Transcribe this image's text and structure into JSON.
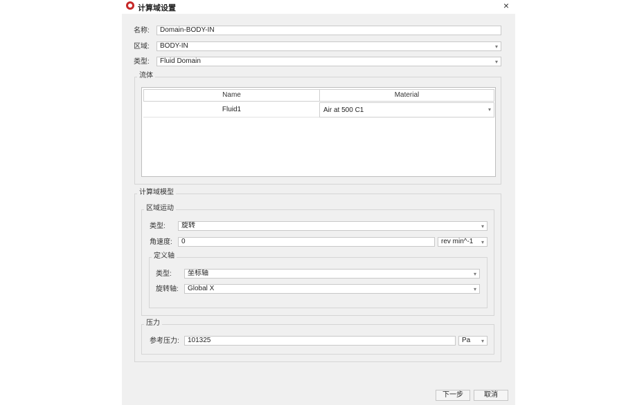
{
  "window": {
    "title": "计算域设置",
    "close_label": "×"
  },
  "general": {
    "name_label": "名称:",
    "name_value": "Domain-BODY-IN",
    "zone_label": "区域:",
    "zone_value": "BODY-IN",
    "type_label": "类型:",
    "type_value": "Fluid Domain"
  },
  "fluid": {
    "group_title": "流体",
    "columns": [
      "Name",
      "Material"
    ],
    "rows": [
      {
        "name": "Fluid1",
        "material": "Air at 500 C1"
      }
    ]
  },
  "domain_model": {
    "group_title": "计算域模型",
    "motion": {
      "group_title": "区域运动",
      "type_label": "类型:",
      "type_value": "旋转",
      "angular_velocity_label": "角速度:",
      "angular_velocity_value": "0",
      "angular_velocity_unit": "rev min^-1",
      "axis": {
        "group_title": "定义轴",
        "type_label": "类型:",
        "type_value": "坐标轴",
        "rotation_axis_label": "旋转轴:",
        "rotation_axis_value": "Global X"
      }
    },
    "pressure": {
      "group_title": "压力",
      "reference_label": "参考压力:",
      "reference_value": "101325",
      "reference_unit": "Pa"
    }
  },
  "buttons": {
    "next": "下一步",
    "cancel": "取消"
  },
  "icons": {
    "dropdown": "▾"
  }
}
